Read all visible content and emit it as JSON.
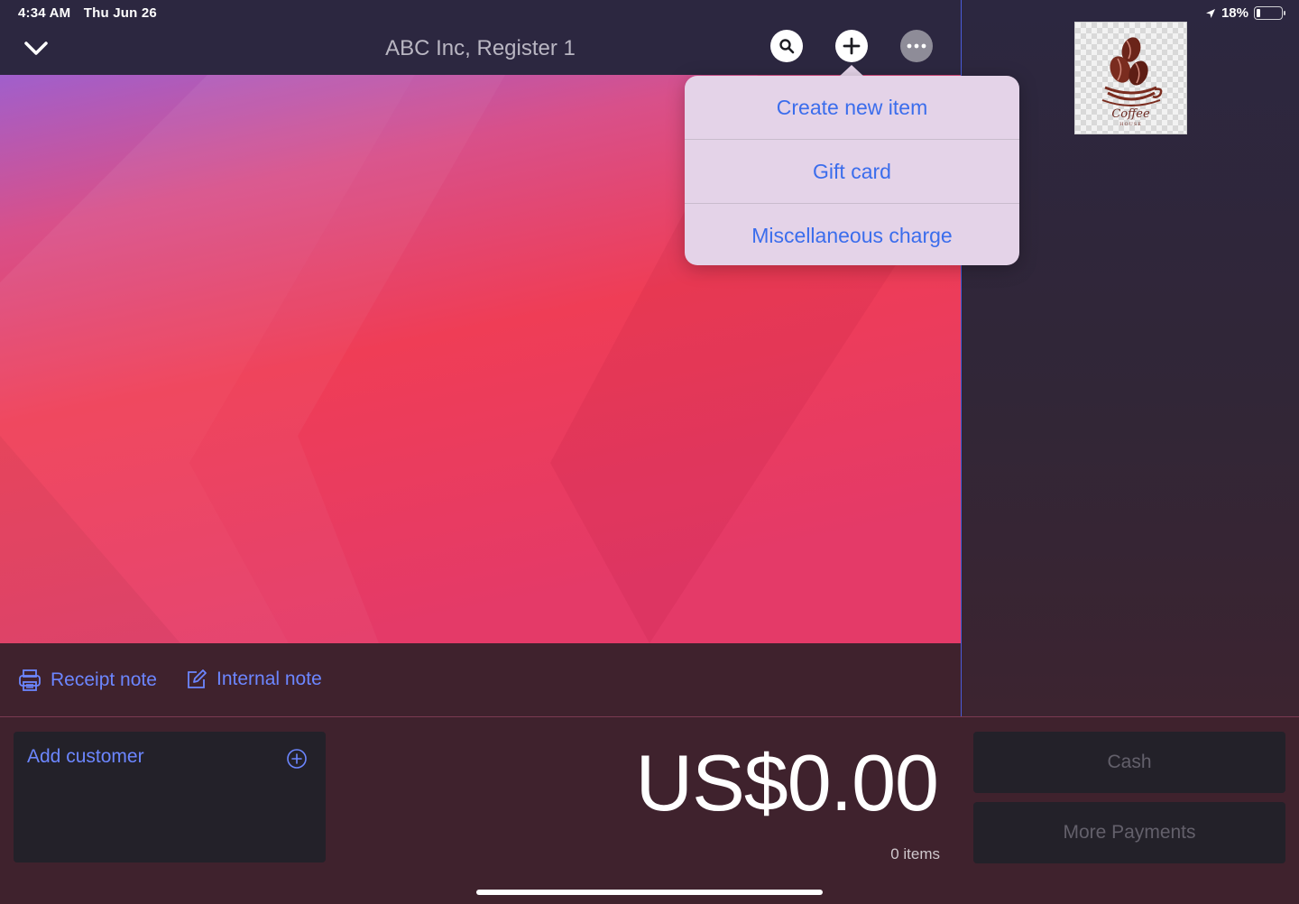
{
  "status_bar": {
    "time": "4:34 AM",
    "date": "Thu Jun 26",
    "battery_percent": "18%",
    "battery_level": 0.18,
    "icons": [
      "location-arrow-icon",
      "battery-icon"
    ]
  },
  "header": {
    "title": "ABC Inc, Register 1",
    "buttons": [
      "chevron-down-icon",
      "search-icon",
      "plus-icon",
      "more-icon"
    ]
  },
  "add_menu": {
    "items": [
      {
        "label": "Create new item"
      },
      {
        "label": "Gift card"
      },
      {
        "label": "Miscellaneous charge"
      }
    ]
  },
  "notes": {
    "receipt_note": "Receipt note",
    "internal_note": "Internal note"
  },
  "logo": {
    "word": "Coffee",
    "sub": "HOUSE"
  },
  "cart": {
    "add_customer": "Add customer",
    "total": "US$0.00",
    "items_count": "0 items"
  },
  "payments": {
    "cash": "Cash",
    "more": "More Payments"
  },
  "colors": {
    "accent": "#6c86ff",
    "menu_text": "#3b6dec",
    "panel_bg": "#2c2740",
    "footer_bg": "#3f222d"
  }
}
